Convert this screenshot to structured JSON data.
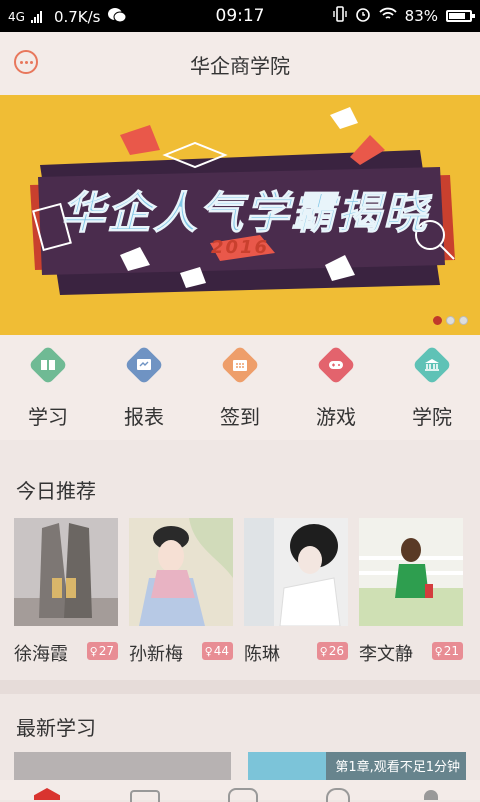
{
  "status_bar": {
    "network": "4G",
    "speed": "0.7K/s",
    "time": "09:17",
    "battery": "83%"
  },
  "header": {
    "title": "华企商学院"
  },
  "banner": {
    "headline": "华企人气学霸揭晓",
    "year": "2016",
    "page_count": 3,
    "active_page": 1
  },
  "nav": [
    {
      "label": "学习",
      "icon": "book-icon",
      "color": "#6fba94"
    },
    {
      "label": "报表",
      "icon": "report-icon",
      "color": "#6f93c3"
    },
    {
      "label": "签到",
      "icon": "calendar-icon",
      "color": "#ee9e6a"
    },
    {
      "label": "游戏",
      "icon": "gamepad-icon",
      "color": "#e3636d"
    },
    {
      "label": "学院",
      "icon": "institution-icon",
      "color": "#5fc2b6"
    }
  ],
  "recommend": {
    "title": "今日推荐",
    "items": [
      {
        "name": "徐海霞",
        "count": "27"
      },
      {
        "name": "孙新梅",
        "count": "44"
      },
      {
        "name": "陈琳",
        "count": "26"
      },
      {
        "name": "李文静",
        "count": "21"
      }
    ]
  },
  "latest": {
    "title": "最新学习",
    "caption": "第1章,观看不足1分钟"
  },
  "colors": {
    "accent": "#e8775c",
    "badge": "#e88d94",
    "banner": "#f0bd35"
  }
}
